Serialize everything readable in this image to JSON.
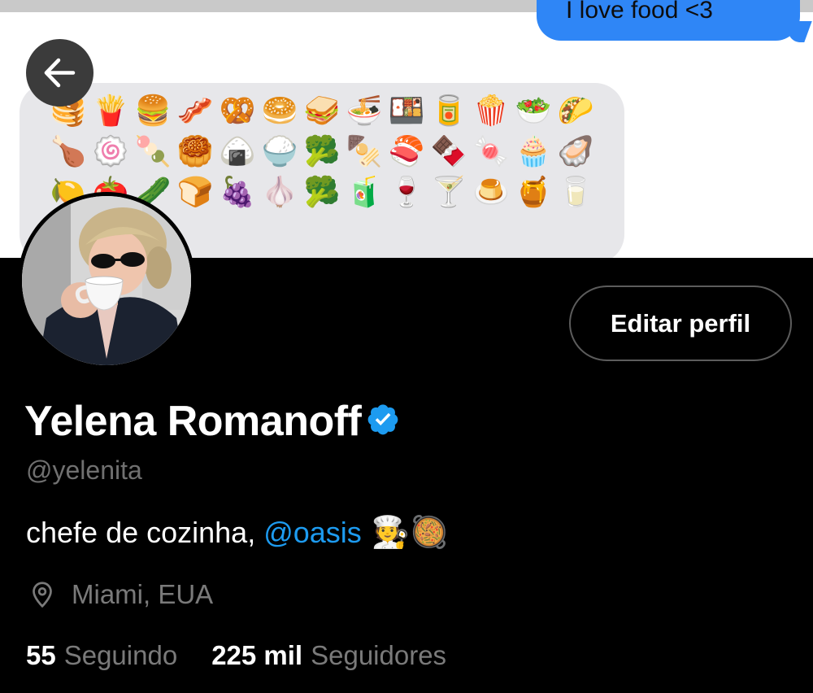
{
  "banner": {
    "message_text": "I love food <3",
    "emojis": [
      "🥞",
      "🍟",
      "🍔",
      "🥓",
      "🥨",
      "🥯",
      "🥪",
      "🍜",
      "🍱",
      "🥫",
      "🍿",
      "🥗",
      "🌮",
      "🍗",
      "🍥",
      "🍡",
      "🥮",
      "🍙",
      "🍚",
      "🥦",
      "🍢",
      "🍣",
      "🍫",
      "🍬",
      "🧁",
      "🦪",
      "🍋",
      "🍅",
      "🥒",
      "🍞",
      "🍇",
      "🧄",
      "🥦",
      "🧃",
      "🍷",
      "🍸",
      "🍮",
      "🍯",
      "🥛"
    ]
  },
  "header": {
    "back_icon": "arrow-left-icon"
  },
  "profile": {
    "edit_button_label": "Editar perfil",
    "name": "Yelena Romanoff",
    "verified_icon": "verified-badge-icon",
    "handle": "@yelenita",
    "bio_text": "chefe de cozinha,",
    "bio_mention": "@oasis",
    "bio_emojis": "🧑‍🍳🥘",
    "location_icon": "location-pin-icon",
    "location": "Miami, EUA",
    "following_count": "55",
    "following_label": "Seguindo",
    "followers_count": "225 mil",
    "followers_label": "Seguidores"
  },
  "colors": {
    "background": "#000000",
    "accent": "#1d9bf0",
    "message_bubble": "#2f86f6",
    "secondary_text": "#707070"
  }
}
